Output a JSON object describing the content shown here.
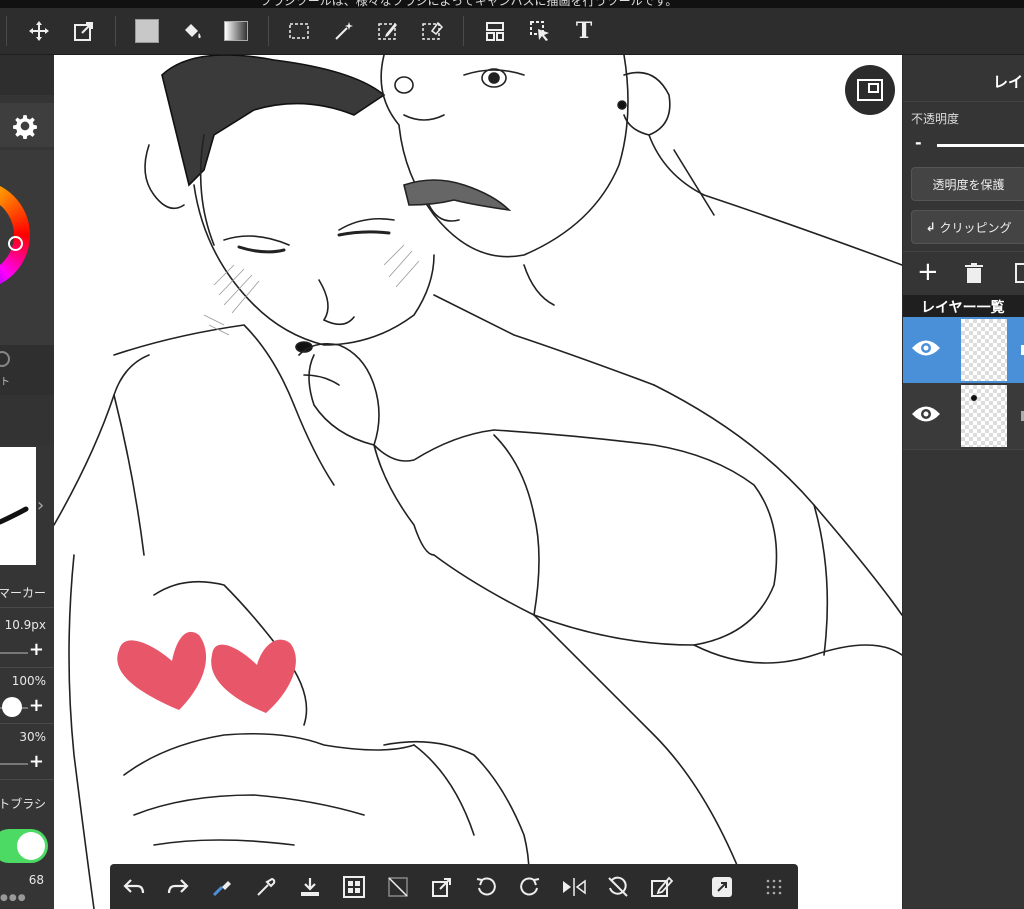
{
  "hint_text": "フラシツールは、様々なフラシによってキャンハスに描画を行うツールです。",
  "toolbar": {
    "tools": [
      {
        "name": "move-icon"
      },
      {
        "name": "transform-icon"
      },
      {
        "name": "fill-color-icon"
      },
      {
        "name": "bucket-icon"
      },
      {
        "name": "gradient-icon"
      },
      {
        "name": "select-rect-icon"
      },
      {
        "name": "magic-wand-icon"
      },
      {
        "name": "select-pen-icon"
      },
      {
        "name": "select-eraser-icon"
      },
      {
        "name": "frame-divide-icon"
      },
      {
        "name": "operation-icon"
      },
      {
        "name": "text-icon"
      }
    ]
  },
  "left_panel": {
    "settings_icon": "gear-icon",
    "brush_name": "マーカー",
    "brush_size": "10.9px",
    "opacity": "100%",
    "hardness": "30%",
    "stabilizer_label": "トブラシ",
    "bottom_value": "68",
    "partial_label": "ト",
    "more_dots": "●●●"
  },
  "right_panel": {
    "title": "レイ",
    "opacity_label": "不透明度",
    "minus": "-",
    "protect_alpha": "透明度を保護",
    "clipping": "クリッピング",
    "layer_list_title": "レイヤー一覧",
    "layers": [
      {
        "visible": true,
        "selected": true
      },
      {
        "visible": true,
        "selected": false
      }
    ]
  },
  "colors": {
    "accent_blue": "#4a90d9",
    "toggle_green": "#4cd964",
    "heart_red": "#e8566a"
  },
  "bottom_toolbar": {
    "tools": [
      "undo-icon",
      "redo-icon",
      "brush-eraser-icon",
      "eyedropper-icon",
      "import-icon",
      "grid-icon",
      "clear-icon",
      "transform-icon",
      "rotate-left-icon",
      "rotate-right-icon",
      "flip-icon",
      "rotate-reset-icon",
      "edit-icon",
      "share-icon",
      "menu-grid-icon"
    ]
  }
}
